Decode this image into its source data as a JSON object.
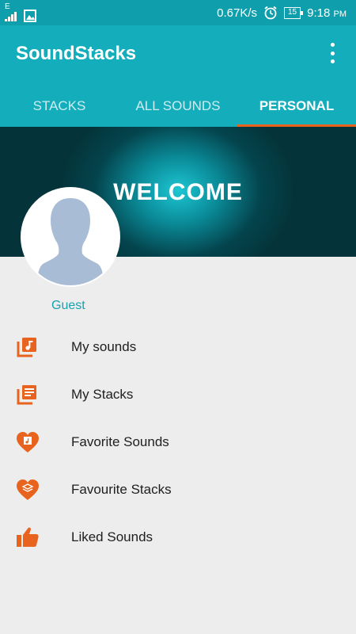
{
  "status_bar": {
    "network_type": "E",
    "net_speed": "0.67K/s",
    "battery": "15",
    "time": "9:18",
    "ampm": "PM"
  },
  "app": {
    "title": "SoundStacks"
  },
  "tabs": [
    {
      "label": "STACKS",
      "active": false
    },
    {
      "label": "ALL SOUNDS",
      "active": false
    },
    {
      "label": "PERSONAL",
      "active": true
    }
  ],
  "banner": {
    "text": "WELCOME"
  },
  "user": {
    "name": "Guest"
  },
  "menu": [
    {
      "label": "My sounds",
      "icon": "music-library-icon"
    },
    {
      "label": "My Stacks",
      "icon": "stack-list-icon"
    },
    {
      "label": "Favorite Sounds",
      "icon": "heart-music-icon"
    },
    {
      "label": "Favourite Stacks",
      "icon": "heart-stack-icon"
    },
    {
      "label": "Liked Sounds",
      "icon": "thumbs-up-icon"
    }
  ],
  "colors": {
    "primary": "#14adbb",
    "status_bar": "#0f9fac",
    "accent": "#e8641e",
    "guest_text": "#16a3b1"
  }
}
